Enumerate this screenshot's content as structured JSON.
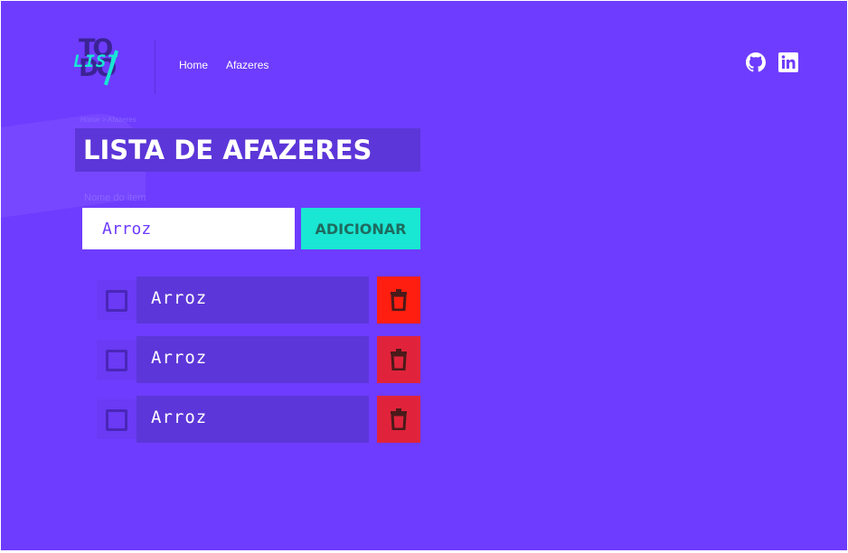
{
  "header": {
    "logo": {
      "todo_text": "TODO",
      "list_text": "LIST"
    },
    "nav": [
      {
        "label": "Home"
      },
      {
        "label": "Afazeres"
      }
    ],
    "social": [
      "github-icon",
      "linkedin-icon"
    ]
  },
  "breadcrumb": "Home > Afazeres",
  "page_title": "LISTA DE AFAZERES",
  "form": {
    "label": "Nome do item",
    "input_value": "Arroz",
    "button_label": "ADICIONAR"
  },
  "items": [
    {
      "text": "Arroz",
      "checked": false,
      "delete_color": "#ff1e0f"
    },
    {
      "text": "Arroz",
      "checked": false,
      "delete_color": "#e0233a"
    },
    {
      "text": "Arroz",
      "checked": false,
      "delete_color": "#e0233a"
    }
  ],
  "colors": {
    "background": "#6e3cff",
    "panel": "#5c36d8",
    "accent": "#19e6d3",
    "delete": "#e0233a"
  }
}
